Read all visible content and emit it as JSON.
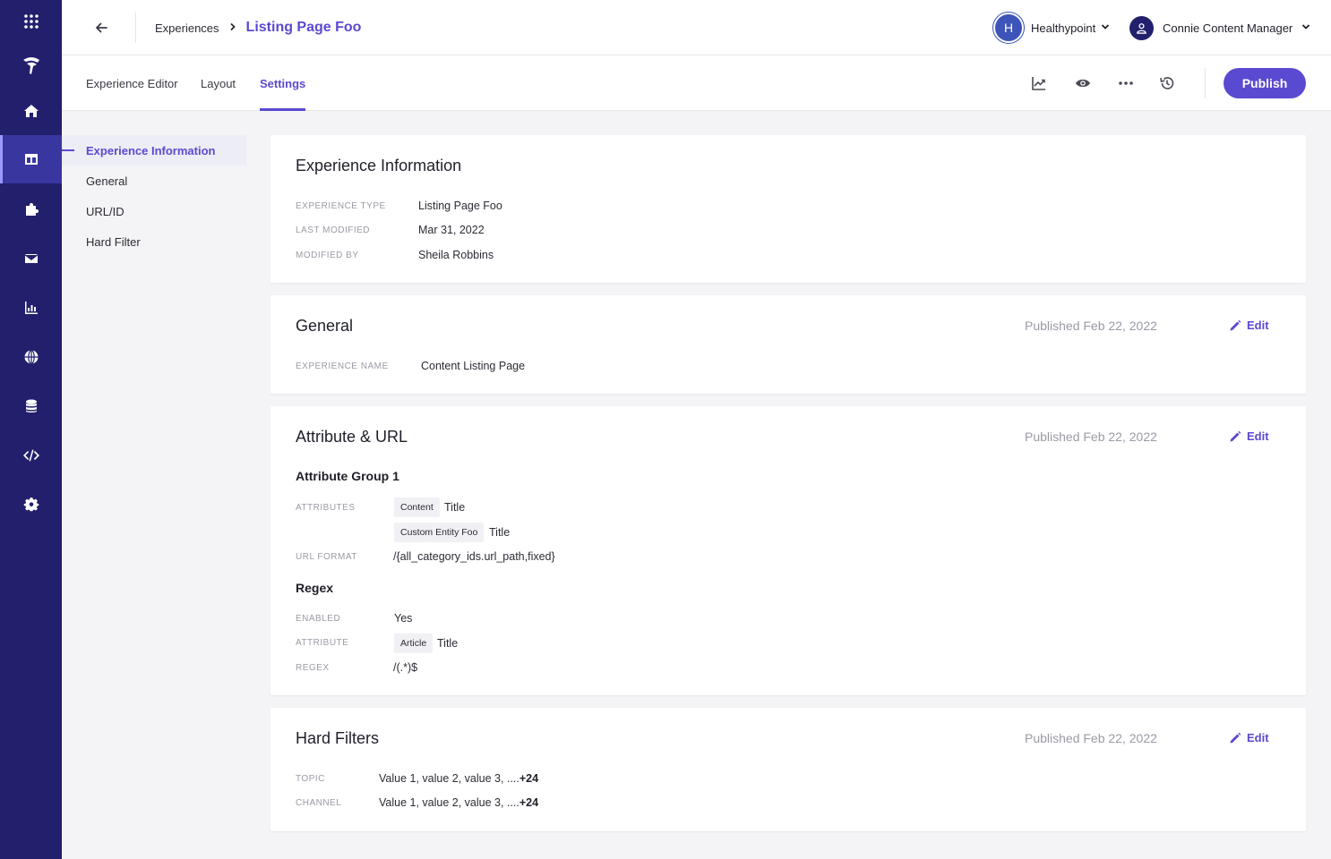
{
  "rail": {
    "items": [
      {
        "name": "apps-grid-icon"
      },
      {
        "name": "brand-logo-icon"
      },
      {
        "name": "home-icon"
      },
      {
        "name": "experiences-icon"
      },
      {
        "name": "puzzle-icon"
      },
      {
        "name": "mail-icon"
      },
      {
        "name": "analytics-icon"
      },
      {
        "name": "globe-icon"
      },
      {
        "name": "database-icon"
      },
      {
        "name": "code-icon"
      },
      {
        "name": "gear-icon"
      }
    ],
    "active_index": 3,
    "bg_color": "#221f6d"
  },
  "header": {
    "breadcrumb_parent": "Experiences",
    "breadcrumb_current": "Listing Page Foo",
    "org_initial": "H",
    "org_name": "Healthypoint",
    "user_name": "Connie Content Manager"
  },
  "tabs": {
    "items": [
      "Experience Editor",
      "Layout",
      "Settings"
    ],
    "active": "Settings"
  },
  "toolbar": {
    "icons": [
      "analytics-trend-icon",
      "preview-eye-icon",
      "more-dots-icon",
      "history-icon"
    ],
    "publish_label": "Publish",
    "accent_color": "#5a4ad1"
  },
  "sidenav": {
    "items": [
      "Experience Information",
      "General",
      "URL/ID",
      "Hard Filter"
    ],
    "active_index": 0
  },
  "experience_info": {
    "title": "Experience Information",
    "rows": [
      {
        "label": "EXPERIENCE TYPE",
        "value": "Listing Page Foo"
      },
      {
        "label": "LAST MODIFIED",
        "value": "Mar 31, 2022"
      },
      {
        "label": "MODIFIED BY",
        "value": "Sheila Robbins"
      }
    ]
  },
  "general": {
    "title": "General",
    "status": "Published Feb 22, 2022",
    "edit_label": "Edit",
    "rows": [
      {
        "label": "EXPERIENCE NAME",
        "value": "Content Listing Page"
      }
    ]
  },
  "attribute_url": {
    "title": "Attribute & URL",
    "status": "Published Feb 22, 2022",
    "edit_label": "Edit",
    "group_title": "Attribute Group 1",
    "attributes_label": "ATTRIBUTES",
    "attributes": [
      {
        "chip": "Content",
        "text": "Title"
      },
      {
        "chip": "Custom Entity Foo",
        "text": "Title"
      }
    ],
    "url_format_label": "URL FORMAT",
    "url_format": "/{all_category_ids.url_path,fixed}",
    "regex_title": "Regex",
    "enabled_label": "ENABLED",
    "enabled_value": "Yes",
    "attribute_label": "ATTRIBUTE",
    "attribute_chip": "Article",
    "attribute_text": "Title",
    "regex_label": "REGEX",
    "regex_value": "/(.*)$"
  },
  "hard_filters": {
    "title": "Hard Filters",
    "status": "Published Feb 22, 2022",
    "edit_label": "Edit",
    "rows": [
      {
        "label": "TOPIC",
        "value": "Value 1, value 2, value 3, ....",
        "more": "+24"
      },
      {
        "label": "CHANNEL",
        "value": "Value 1, value 2, value 3, ....",
        "more": "+24"
      }
    ]
  }
}
